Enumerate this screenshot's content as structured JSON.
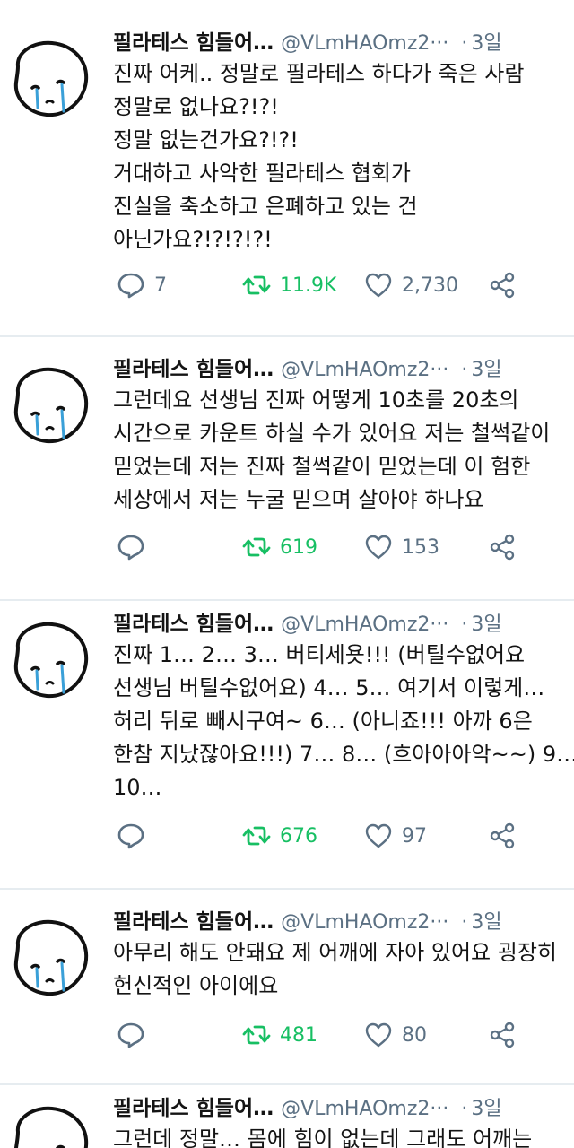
{
  "tweets": [
    {
      "name": "필라테스 힘들어…",
      "handle": "@VLmHAOmz2···",
      "dot": "·",
      "time": "3일",
      "text": "진짜 어케.. 정말로 필라테스 하다가 죽은 사람\n정말로 없나요?!?!\n정말 없는건가요?!?!\n거대하고 사악한 필라테스 협회가\n진실을 축소하고 은폐하고 있는 건\n아닌가요?!?!?!?!",
      "replies": "7",
      "retweets": "11.9K",
      "likes": "2,730"
    },
    {
      "name": "필라테스 힘들어…",
      "handle": "@VLmHAOmz2···",
      "dot": "·",
      "time": "3일",
      "text": "그런데요 선생님 진짜 어떻게 10초를 20초의\n시간으로 카운트 하실 수가 있어요 저는 철썩같이\n믿었는데 저는 진짜 철썩같이 믿었는데 이 험한\n세상에서 저는 누굴 믿으며 살아야 하나요",
      "replies": "",
      "retweets": "619",
      "likes": "153"
    },
    {
      "name": "필라테스 힘들어…",
      "handle": "@VLmHAOmz2···",
      "dot": "·",
      "time": "3일",
      "text": "진짜 1… 2… 3… 버티세욧!!! (버틸수없어요\n선생님 버틸수없어요) 4… 5… 여기서 이렇게…\n허리 뒤로 빼시구여~ 6… (아니죠!!! 아까 6은\n한참 지났잖아요!!!) 7… 8… (흐아아아악~~) 9…\n10…",
      "replies": "",
      "retweets": "676",
      "likes": "97"
    },
    {
      "name": "필라테스 힘들어…",
      "handle": "@VLmHAOmz2···",
      "dot": "·",
      "time": "3일",
      "text": "아무리 해도 안돼요 제 어깨에 자아 있어요 굉장히\n헌신적인 아이에요",
      "replies": "",
      "retweets": "481",
      "likes": "80"
    },
    {
      "name": "필라테스 힘들어…",
      "handle": "@VLmHAOmz2···",
      "dot": "·",
      "time": "3일",
      "text": "그런데 정말… 몸에 힘이 없는데 그래도 어깨는",
      "replies": "",
      "retweets": "",
      "likes": ""
    }
  ],
  "icons": {
    "avatar": "crying-face-avatar-icon",
    "reply": "reply-bubble-icon",
    "retweet": "retweet-arrows-icon",
    "like": "heart-outline-icon",
    "share": "share-nodes-icon"
  },
  "colors": {
    "text": "#141414",
    "muted": "#5b7083",
    "retweet": "#17bf63",
    "divider": "#e6ecf0",
    "tear": "#3aa0d8"
  }
}
